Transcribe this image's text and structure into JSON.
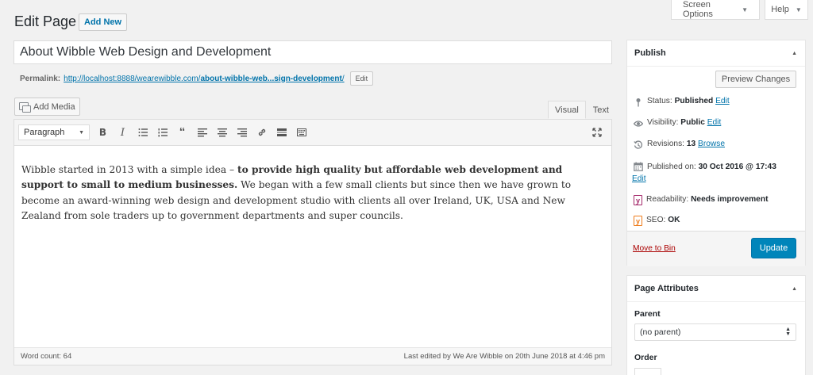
{
  "screen_options": {
    "label": "Screen Options"
  },
  "help": {
    "label": "Help"
  },
  "header": {
    "title": "Edit Page",
    "add_new": "Add New"
  },
  "post": {
    "title": "About Wibble Web Design and Development",
    "permalink_label": "Permalink:",
    "permalink_base": "http://localhost:8888/wearewibble.com/",
    "permalink_slug": "about-wibble-web...sign-development",
    "permalink_end": "/",
    "permalink_edit": "Edit"
  },
  "media": {
    "add_media": "Add Media"
  },
  "editor": {
    "tab_visual": "Visual",
    "tab_text": "Text",
    "format": "Paragraph",
    "content_start": "Wibble started in 2013 with a simple idea – ",
    "content_bold": "to provide high quality but affordable web development and support to small to medium businesses.",
    "content_end": " We began with a few small clients but since then we have grown to become an award-winning web design and development studio with clients all over Ireland, UK, USA and New Zealand from sole traders up to government departments and super councils.",
    "word_count": "Word count: 64",
    "last_edited": "Last edited by We Are Wibble on 20th June 2018 at 4:46 pm"
  },
  "publish": {
    "title": "Publish",
    "preview": "Preview Changes",
    "status_label": "Status:",
    "status_value": "Published",
    "visibility_label": "Visibility:",
    "visibility_value": "Public",
    "revisions_label": "Revisions:",
    "revisions_value": "13",
    "revisions_link": "Browse",
    "published_label": "Published on:",
    "published_value": "30 Oct 2016 @ 17:43",
    "edit": "Edit",
    "readability_label": "Readability:",
    "readability_value": "Needs improvement",
    "seo_label": "SEO:",
    "seo_value": "OK",
    "move_to_bin": "Move to Bin",
    "update": "Update"
  },
  "attributes": {
    "title": "Page Attributes",
    "parent_label": "Parent",
    "parent_value": "(no parent)",
    "order_label": "Order"
  },
  "colors": {
    "accent": "#0073aa",
    "primary_button": "#0085ba",
    "danger": "#aa0000",
    "yoast_red": "#a4286a",
    "yoast_orange": "#ee7c1b"
  }
}
